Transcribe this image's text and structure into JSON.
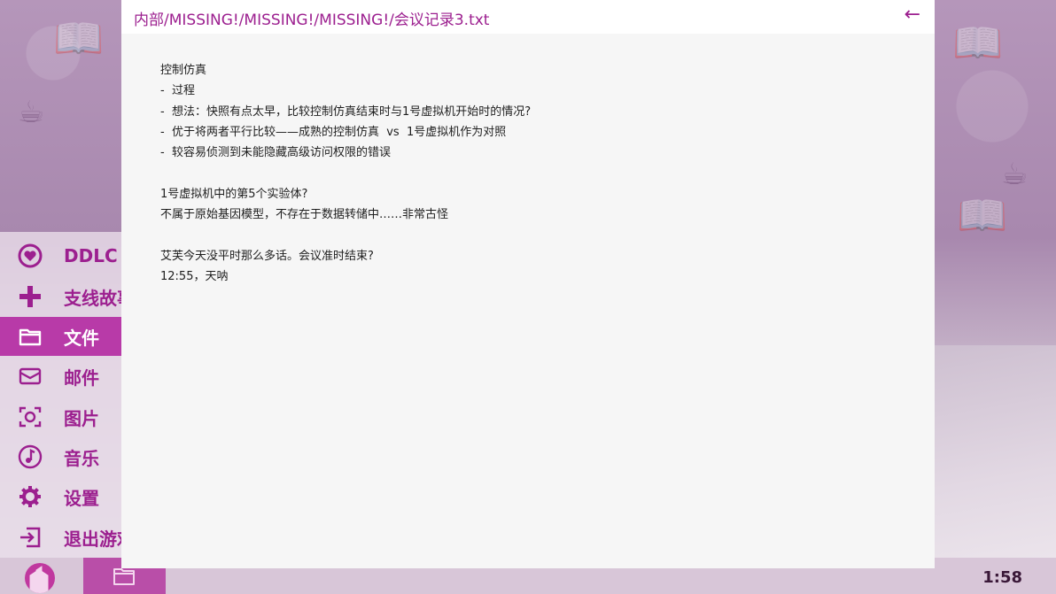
{
  "window": {
    "path": "内部/MISSING!/MISSING!/MISSING!/会议记录3.txt",
    "back_icon": "←"
  },
  "document": {
    "lines": [
      "控制仿真",
      "-  过程",
      "-  想法：快照有点太早，比较控制仿真结束时与1号虚拟机开始时的情况?",
      "-  优于将两者平行比较——成熟的控制仿真  vs  1号虚拟机作为对照",
      "-  较容易侦测到未能隐藏高级访问权限的错误",
      "",
      "1号虚拟机中的第5个实验体?",
      "不属于原始基因模型，不存在于数据转储中……非常古怪",
      "",
      "艾芙今天没平时那么多话。会议准时结束?",
      "12:55，天呐"
    ]
  },
  "sidebar": {
    "items": [
      {
        "label": "DDLC",
        "icon": "heart-icon"
      },
      {
        "label": "支线故事",
        "icon": "plus-icon"
      },
      {
        "label": "文件",
        "icon": "folder-icon"
      },
      {
        "label": "邮件",
        "icon": "mail-icon"
      },
      {
        "label": "图片",
        "icon": "camera-icon"
      },
      {
        "label": "音乐",
        "icon": "music-icon"
      },
      {
        "label": "设置",
        "icon": "gear-icon"
      },
      {
        "label": "退出游戏",
        "icon": "exit-icon"
      }
    ]
  },
  "taskbar": {
    "clock": "1:58",
    "open_app_icon": "folder-icon"
  },
  "colors": {
    "accent": "#9c1f8f",
    "active": "#b83aa8",
    "background": "#b79cbc"
  }
}
